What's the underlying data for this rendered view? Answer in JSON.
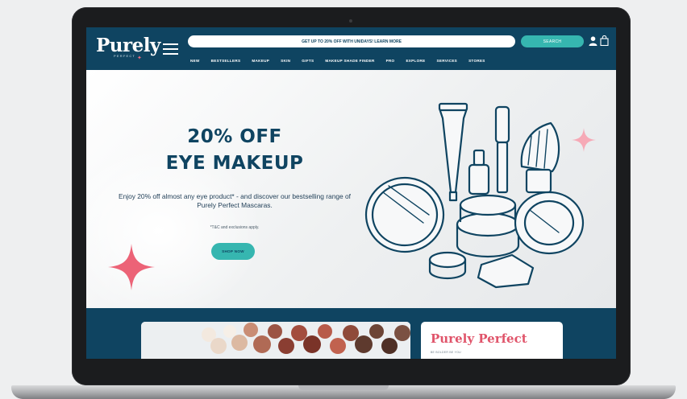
{
  "brand": {
    "logo_text": "Purely",
    "logo_subtext": "PERFECT"
  },
  "header": {
    "promo_text": "GET UP TO 20% OFF WITH UNIDAYS! LEARN MORE",
    "search_label": "SEARCH",
    "icons": [
      "menu-icon",
      "user-icon",
      "shopping-bag-icon"
    ]
  },
  "nav": {
    "items": [
      "NEW",
      "BESTSELLERS",
      "MAKEUP",
      "SKIN",
      "GIFTS",
      "MAKEUP SHADE FINDER",
      "PRO",
      "EXPLORE",
      "SERVICES",
      "STORES"
    ]
  },
  "hero": {
    "title_line1": "20% OFF",
    "title_line2": "EYE MAKEUP",
    "description": "Enjoy 20% off almost any eye product* - and discover our bestselling range of Purely Perfect Mascaras.",
    "tc_note": "*T&C and exclusions apply.",
    "cta_label": "SHOP NOW"
  },
  "promo_card": {
    "title": "Purely Perfect",
    "subtitle": "BE BOLDER BE YOU"
  },
  "colors": {
    "brand_navy": "#0f4461",
    "accent_teal": "#36b6b0",
    "accent_pink": "#e0546a"
  }
}
